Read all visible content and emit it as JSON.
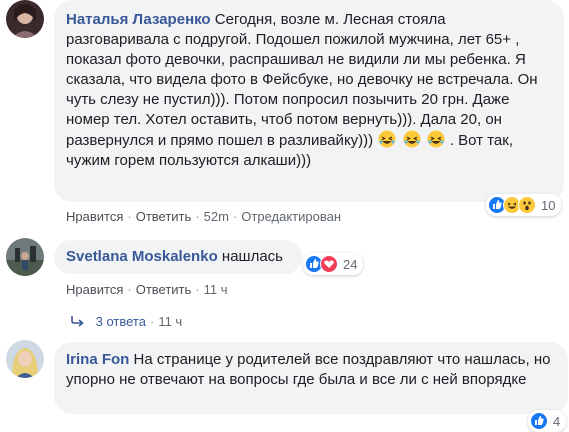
{
  "comments": [
    {
      "author": "Наталья Лазаренко",
      "text": "Сегодня, возле м. Лесная стояла разговаривала с подругой. Подошел пожилой мужчина, лет 65+ , показал фото девочки, распрашивал не видили ли мы ребенка. Я сказала, что видела фото в Фейсбуке, но девочку не встречала. Он чуть слезу не пустил))). Потом попросил позычить 20 грн. Даже номер тел. Хотел оставить, чтоб потом вернуть))). Дала 20, он развернулся и прямо пошел в разливайку)))",
      "text_tail": ". Вот так, чужим горем пользуются алкаши)))",
      "like_label": "Нравится",
      "reply_label": "Ответить",
      "time": "52m",
      "edited_label": "Отредактирован",
      "reaction_count": "10",
      "reaction_icons": [
        "like-icon",
        "haha-icon",
        "wow-icon"
      ]
    },
    {
      "author": "Svetlana Moskalenko",
      "text": "нашлась",
      "like_label": "Нравится",
      "reply_label": "Ответить",
      "time": "11 ч",
      "reaction_count": "24",
      "reaction_icons": [
        "like-icon",
        "love-icon"
      ],
      "replies_label": "3 ответа",
      "replies_time": "11 ч"
    },
    {
      "author": "Irina Fon",
      "text": "На странице у родителей все поздравляют что нашлась, но упорно не отвечают на вопросы где была и все ли с ней впорядке",
      "reaction_count": "4",
      "reaction_icons": [
        "like-icon"
      ]
    }
  ],
  "colors": {
    "link": "#385898",
    "bubble": "#f2f3f5",
    "meta": "#606770",
    "like_blue": "#1877f2",
    "love_red": "#f33e58",
    "emoji_yellow": "#fcc93b"
  }
}
